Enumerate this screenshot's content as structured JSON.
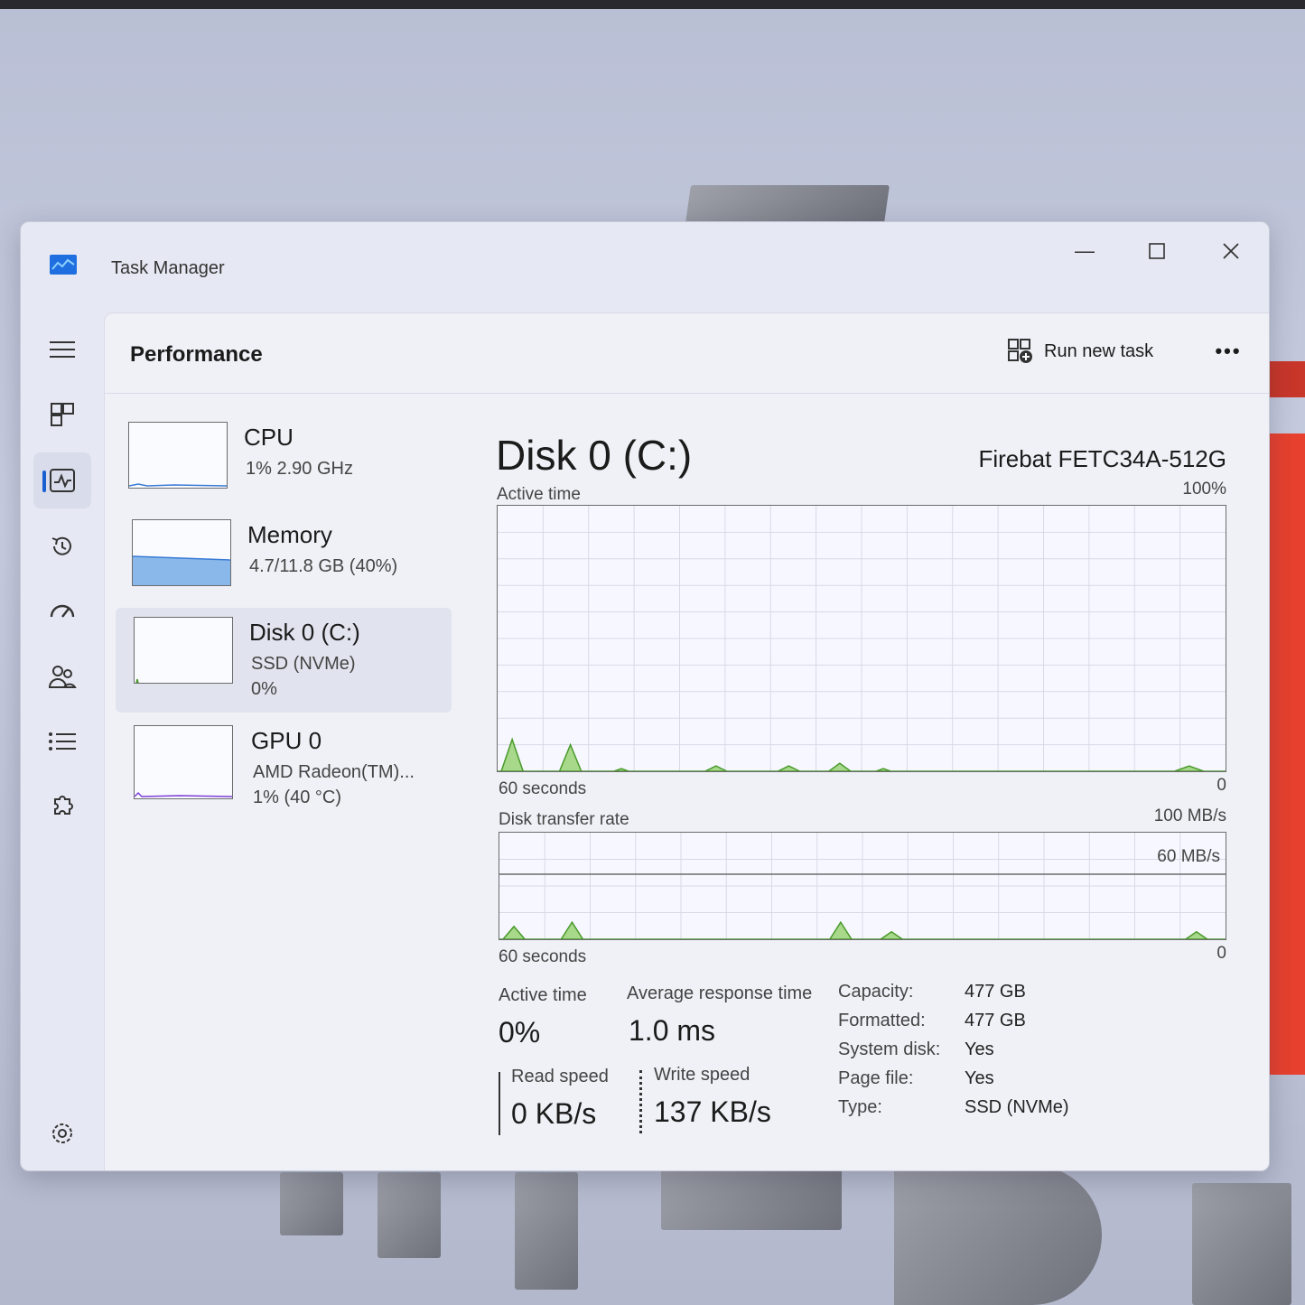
{
  "window": {
    "title": "Task Manager"
  },
  "header": {
    "page_title": "Performance",
    "run_task_label": "Run new task"
  },
  "side_list": [
    {
      "name": "CPU",
      "line1": "1% 2.90 GHz",
      "line2": ""
    },
    {
      "name": "Memory",
      "line1": "4.7/11.8 GB (40%)",
      "line2": ""
    },
    {
      "name": "Disk 0 (C:)",
      "line1": "SSD (NVMe)",
      "line2": "0%"
    },
    {
      "name": "GPU 0",
      "line1": "AMD Radeon(TM)...",
      "line2": "1% (40 °C)"
    }
  ],
  "main": {
    "title": "Disk 0 (C:)",
    "model": "Firebat FETC34A-512G",
    "active_graph": {
      "label": "Active time",
      "max": "100%",
      "min": "0",
      "time": "60 seconds"
    },
    "transfer_graph": {
      "label": "Disk transfer rate",
      "max": "100 MB/s",
      "mid": "60 MB/s",
      "min": "0",
      "time": "60 seconds"
    },
    "stats": {
      "active_time_label": "Active time",
      "active_time_value": "0%",
      "avg_resp_label": "Average response time",
      "avg_resp_value": "1.0 ms",
      "read_label": "Read speed",
      "read_value": "0 KB/s",
      "write_label": "Write speed",
      "write_value": "137 KB/s"
    },
    "props": [
      {
        "key": "Capacity:",
        "value": "477 GB"
      },
      {
        "key": "Formatted:",
        "value": "477 GB"
      },
      {
        "key": "System disk:",
        "value": "Yes"
      },
      {
        "key": "Page file:",
        "value": "Yes"
      },
      {
        "key": "Type:",
        "value": "SSD (NVMe)"
      }
    ]
  },
  "colors": {
    "accent": "#1a5fd0",
    "disk_graph_fill": "#a8d88a",
    "disk_graph_line": "#4a9a2c",
    "memory_fill": "#8ab8ea"
  }
}
